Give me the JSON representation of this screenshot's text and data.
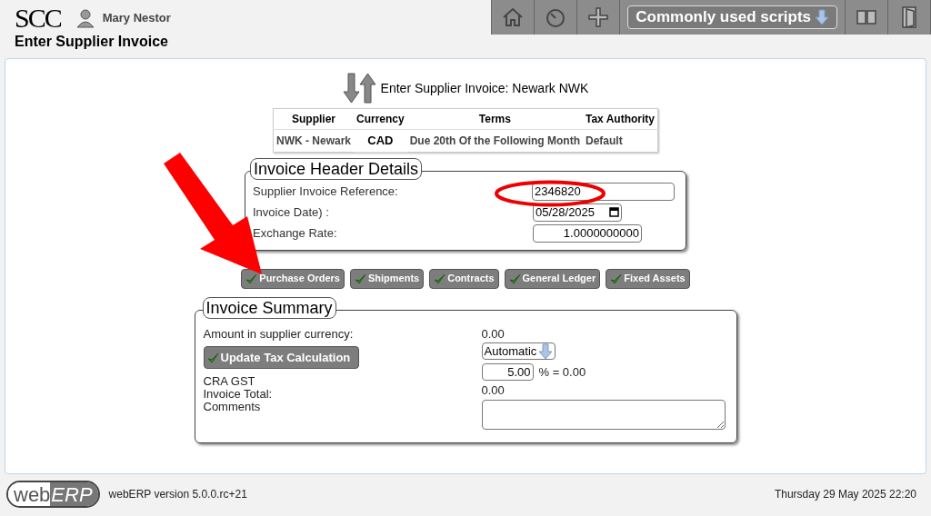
{
  "header": {
    "logo": "SCC",
    "user": "Mary Nestor",
    "page_title": "Enter Supplier Invoice",
    "toolbar": [
      {
        "kind": "home"
      },
      {
        "kind": "gauge"
      },
      {
        "kind": "plus"
      },
      {
        "kind": "menu",
        "label": "Commonly used scripts"
      },
      {
        "kind": "book"
      },
      {
        "kind": "door"
      }
    ]
  },
  "heading": "Enter Supplier Invoice: Newark NWK",
  "supplier_table": {
    "columns": [
      "Supplier",
      "Currency",
      "Terms",
      "Tax Authority"
    ],
    "row": [
      "NWK - Newark",
      "CAD",
      "Due 20th Of the Following Month",
      "Default"
    ]
  },
  "invoice_header": {
    "legend": "Invoice Header Details",
    "fields": [
      {
        "label": "Supplier Invoice Reference:",
        "value": "2346820",
        "kind": "text"
      },
      {
        "label": "Invoice Date) :",
        "value": "05/28/2025",
        "kind": "date"
      },
      {
        "label": "Exchange Rate:",
        "value": "1.0000000000",
        "kind": "number"
      }
    ]
  },
  "buttons": [
    "Purchase Orders",
    "Shipments",
    "Contracts",
    "General Ledger",
    "Fixed Assets"
  ],
  "invoice_summary": {
    "legend": "Invoice Summary",
    "amount_label": "Amount in supplier currency:",
    "amount": "0.00",
    "update_button": "Update Tax Calculation",
    "tax_mode": "Automatic",
    "tax_name": "CRA GST",
    "tax_rate": "5.00",
    "tax_result": "% = 0.00",
    "total_label": "Invoice Total:",
    "total": "0.00",
    "comments_label": "Comments"
  },
  "footer": {
    "logo_left": "web",
    "logo_right": "ERP",
    "version": "webERP version 5.0.0.rc+21",
    "datetime": "Thursday 29 May 2025 22:20"
  }
}
